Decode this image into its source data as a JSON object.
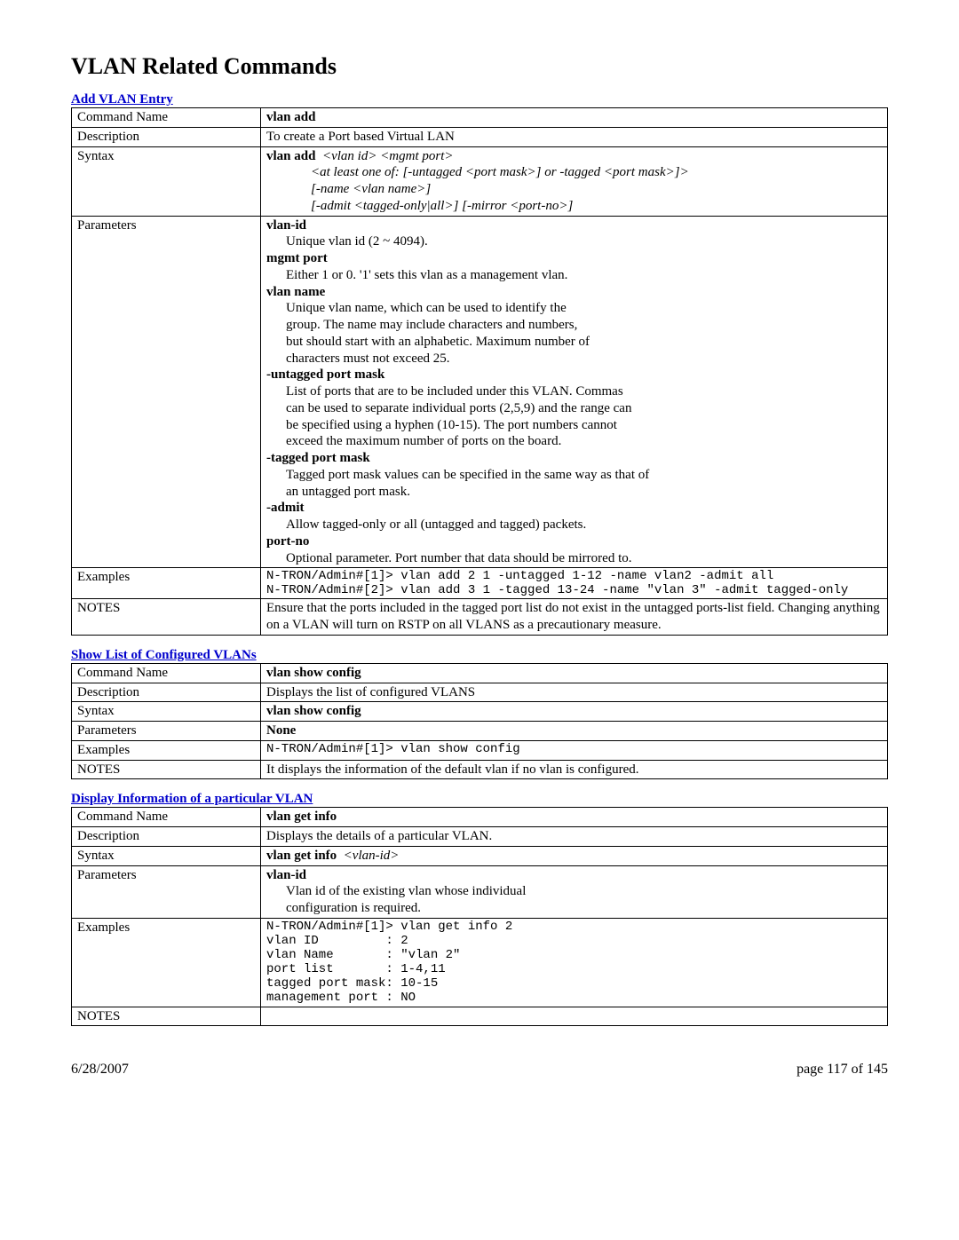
{
  "page_title": "VLAN Related Commands",
  "footer": {
    "date": "6/28/2007",
    "page": "page 117 of 145"
  },
  "labels": {
    "cmd_name": "Command Name",
    "description": "Description",
    "syntax": "Syntax",
    "parameters": "Parameters",
    "examples": "Examples",
    "notes": "NOTES"
  },
  "sections": [
    {
      "title": "Add VLAN Entry",
      "cmd_name": "vlan add",
      "description": "To create a Port based Virtual LAN",
      "syntax_bold": "vlan add",
      "syntax_args": "<vlan id> <mgmt port>",
      "syntax_extra": [
        "<at least one of: [-untagged <port mask>] or -tagged <port mask>]>",
        "[-name <vlan name>]",
        "[-admit <tagged-only|all>] [-mirror <port-no>]"
      ],
      "params": [
        {
          "name": "vlan-id",
          "lines": [
            "Unique vlan id (2 ~ 4094)."
          ]
        },
        {
          "name": "mgmt port",
          "lines": [
            "Either 1 or 0. '1' sets this vlan as a management vlan."
          ]
        },
        {
          "name": "vlan name",
          "lines": [
            "Unique vlan name, which can be used to identify the",
            "group. The name may include characters and numbers,",
            "but should start with an alphabetic. Maximum number of",
            "characters must not exceed 25."
          ]
        },
        {
          "name": "-untagged port mask",
          "lines": [
            "List of ports that are to be included under this VLAN.  Commas",
            "can be used to separate individual ports (2,5,9) and the range can",
            "be specified using a hyphen (10-15).  The port numbers cannot",
            "exceed the maximum number of ports on the board."
          ]
        },
        {
          "name": "-tagged port mask",
          "lines": [
            "Tagged port mask values can be specified in the same way as that of",
            "an untagged port mask."
          ]
        },
        {
          "name": "-admit",
          "lines": [
            "Allow tagged-only or all (untagged and tagged) packets."
          ]
        },
        {
          "name": "port-no",
          "lines": [
            "Optional parameter.  Port number that data should be mirrored to."
          ]
        }
      ],
      "examples": "N-TRON/Admin#[1]> vlan add 2 1 -untagged 1-12 -name vlan2 -admit all\nN-TRON/Admin#[2]> vlan add 3 1 -tagged 13-24 -name \"vlan 3\" -admit tagged-only",
      "notes": "Ensure that the ports included in the tagged port list do not exist in the untagged ports-list field.  Changing anything on a VLAN will turn on RSTP on all VLANS as a precautionary measure."
    },
    {
      "title": "Show List of Configured VLANs",
      "cmd_name": "vlan show config",
      "description": "Displays the list of configured VLANS",
      "syntax_bold": "vlan show config",
      "params_none": "None",
      "examples": "N-TRON/Admin#[1]> vlan show config",
      "notes": "It displays the information of the default vlan if no vlan is configured."
    },
    {
      "title": "Display Information of a particular VLAN",
      "cmd_name": "vlan get info",
      "description": "Displays the details of a particular VLAN.",
      "syntax_bold": "vlan get info",
      "syntax_args": "<vlan-id>",
      "params": [
        {
          "name": "vlan-id",
          "lines": [
            "Vlan id of the existing vlan whose individual",
            "configuration is required."
          ]
        }
      ],
      "examples": "N-TRON/Admin#[1]> vlan get info 2\nvlan ID         : 2\nvlan Name       : \"vlan 2\"\nport list       : 1-4,11\ntagged port mask: 10-15\nmanagement port : NO",
      "notes": ""
    }
  ]
}
